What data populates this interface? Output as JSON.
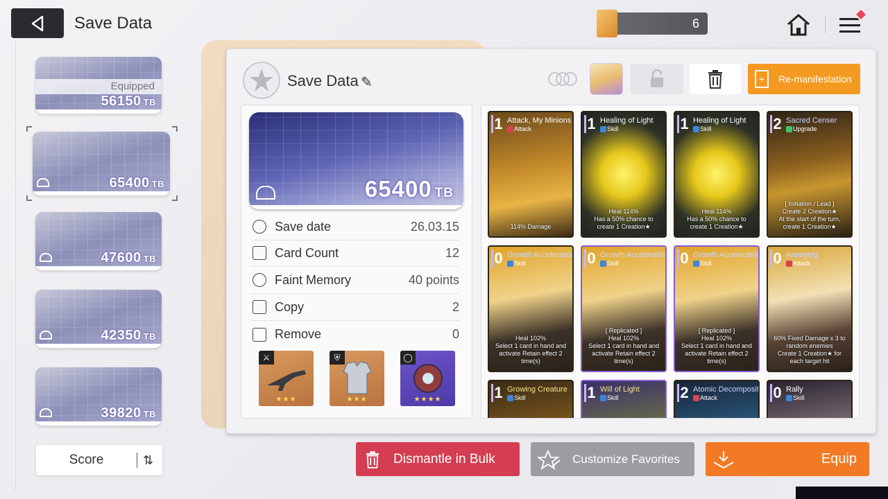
{
  "header": {
    "title": "Save Data",
    "currency_value": "6"
  },
  "save_slots": [
    {
      "value": "56150",
      "unit": "TB",
      "equipped_label": "Equipped"
    },
    {
      "value": "65400",
      "unit": "TB"
    },
    {
      "value": "47600",
      "unit": "TB"
    },
    {
      "value": "42350",
      "unit": "TB"
    },
    {
      "value": "39820",
      "unit": "TB"
    }
  ],
  "sort": {
    "label": "Score"
  },
  "panel": {
    "title": "Save Data",
    "remanifestation_label": "Re-manifestation"
  },
  "detail": {
    "value": "65400",
    "unit": "TB",
    "stats": [
      {
        "label": "Save date",
        "value": "26.03.15"
      },
      {
        "label": "Card Count",
        "value": "12"
      },
      {
        "label": "Faint Memory",
        "value": "40 points"
      },
      {
        "label": "Copy",
        "value": "2"
      },
      {
        "label": "Remove",
        "value": "0"
      }
    ],
    "equipment": [
      {
        "slot": "weapon",
        "stars": "★★★"
      },
      {
        "slot": "armor",
        "stars": "★★★"
      },
      {
        "slot": "accessory",
        "stars": "★★★★"
      }
    ]
  },
  "cards": [
    {
      "cost": "1",
      "name": "Attack, My Minions",
      "type": "Attack",
      "desc": "114% Damage"
    },
    {
      "cost": "1",
      "name": "Healing of Light",
      "type": "Skill",
      "desc": "Heal 114%\nHas a 50% chance to create 1 Creation★"
    },
    {
      "cost": "1",
      "name": "Healing of Light",
      "type": "Skill",
      "desc": "Heal 114%\nHas a 50% chance to create 1 Creation★"
    },
    {
      "cost": "2",
      "name": "Sacred Censer",
      "type": "Upgrade",
      "desc": "[ Initiation / Lead ]\nCreate 2 Creation★\nAt the start of the turn, create 1 Creation★"
    },
    {
      "cost": "0",
      "name": "Growth Acceleration",
      "type": "Skill",
      "desc": "Heal 102%\nSelect 1 card in hand and activate Retain effect 2 time(s)"
    },
    {
      "cost": "0",
      "name": "Growth Acceleration",
      "type": "Skill",
      "desc": "[ Replicated ]\nHeal 102%\nSelect 1 card in hand and activate Retain effect 2 time(s)"
    },
    {
      "cost": "0",
      "name": "Growth Acceleration",
      "type": "Skill",
      "desc": "[ Replicated ]\nHeal 102%\nSelect 1 card in hand and activate Retain effect 2 time(s)"
    },
    {
      "cost": "0",
      "name": "Annoying",
      "type": "Attack",
      "desc": "60% Fixed Damage x 3 to random enemies\nCreate 1 Creation★ for each target hit"
    },
    {
      "cost": "1",
      "name": "Growing Creature",
      "type": "Skill",
      "desc": ""
    },
    {
      "cost": "1",
      "name": "Will of Light",
      "type": "Skill",
      "desc": ""
    },
    {
      "cost": "2",
      "name": "Atomic Decomposition",
      "type": "Attack",
      "desc": ""
    },
    {
      "cost": "0",
      "name": "Rally",
      "type": "Skill",
      "desc": ""
    }
  ],
  "actions": {
    "dismantle": "Dismantle in Bulk",
    "favorites": "Customize Favorites",
    "equip": "Equip"
  }
}
